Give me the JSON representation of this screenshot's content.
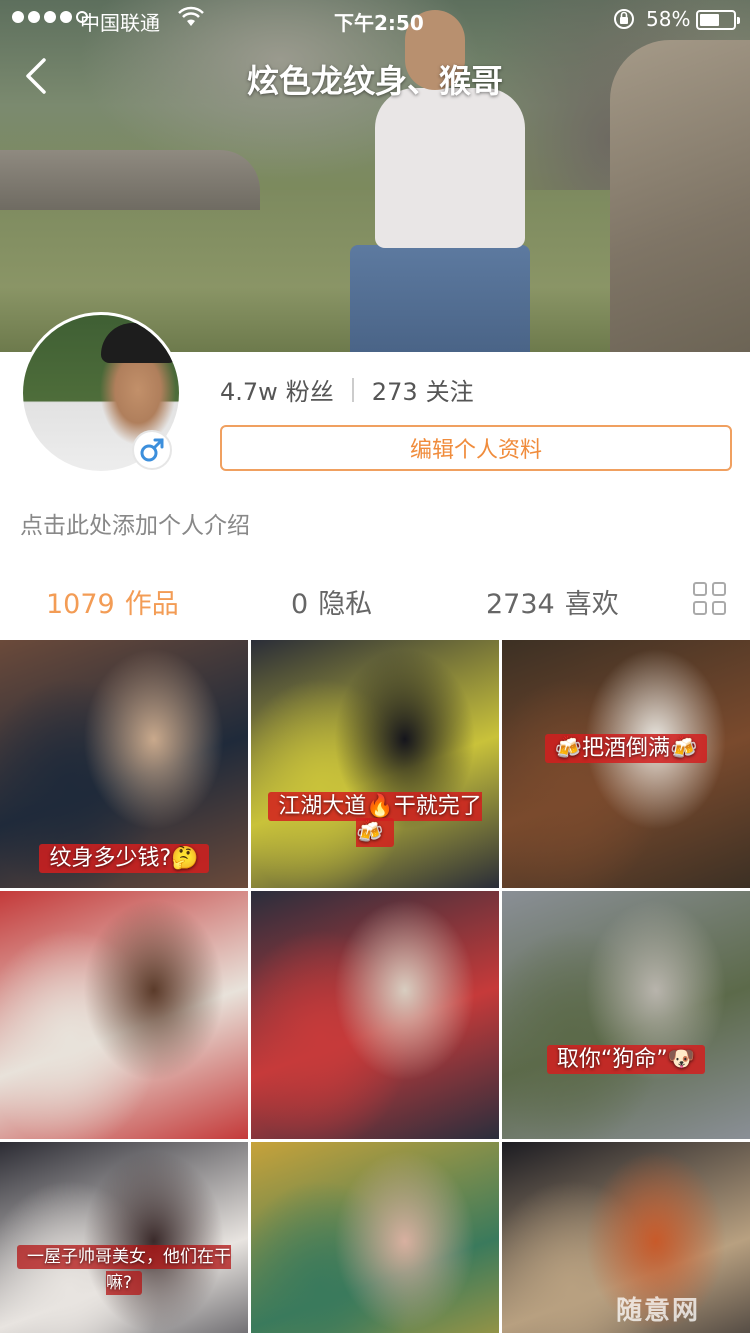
{
  "status_bar": {
    "carrier": "中国联通",
    "time": "下午2:50",
    "battery": "58%",
    "battery_level": 0.58
  },
  "nav": {
    "title": "炫色龙纹身、猴哥",
    "back_icon": "chevron-left-icon"
  },
  "profile": {
    "gender_icon": "male-icon",
    "followers_count": "4.7w",
    "followers_label": "粉丝",
    "following_count": "273",
    "following_label": "关注",
    "edit_button": "编辑个人资料",
    "bio_placeholder": "点击此处添加个人介绍"
  },
  "tabs": [
    {
      "count": "1079",
      "label": "作品",
      "active": true
    },
    {
      "count": "0",
      "label": "隐私",
      "active": false
    },
    {
      "count": "2734",
      "label": "喜欢",
      "active": false
    }
  ],
  "grid_toggle_icon": "grid-icon",
  "videos": [
    {
      "caption": "纹身多少钱?🤔",
      "colors": [
        "#6b4a3a",
        "#1f2a3a",
        "#c9a98c"
      ]
    },
    {
      "caption": "江湖大道🔥干就完了🍻",
      "colors": [
        "#2a2d38",
        "#c9c23a",
        "#15151c"
      ]
    },
    {
      "caption": "🍻把酒倒满🍻",
      "colors": [
        "#3c3024",
        "#7a4a2d",
        "#e8e6e0"
      ]
    },
    {
      "caption": "",
      "colors": [
        "#c43a3a",
        "#e8e2da",
        "#5b3b2a"
      ]
    },
    {
      "caption": "",
      "colors": [
        "#2a2e3c",
        "#c63a3a",
        "#d8cdc0"
      ]
    },
    {
      "caption": "取你“狗命”🐶",
      "colors": [
        "#8a8f96",
        "#5c6a4a",
        "#b8b4ac"
      ]
    },
    {
      "caption": "一屋子帅哥美女，他们在干嘛?",
      "colors": [
        "#2c2c34",
        "#e8e4e0",
        "#3a2a2a"
      ]
    },
    {
      "caption": "",
      "colors": [
        "#c7a23a",
        "#3a7a5c",
        "#d8b0a0"
      ]
    },
    {
      "caption": "",
      "colors": [
        "#1c1c22",
        "#b8a080",
        "#c85a2a"
      ]
    }
  ],
  "watermark": "随意网"
}
